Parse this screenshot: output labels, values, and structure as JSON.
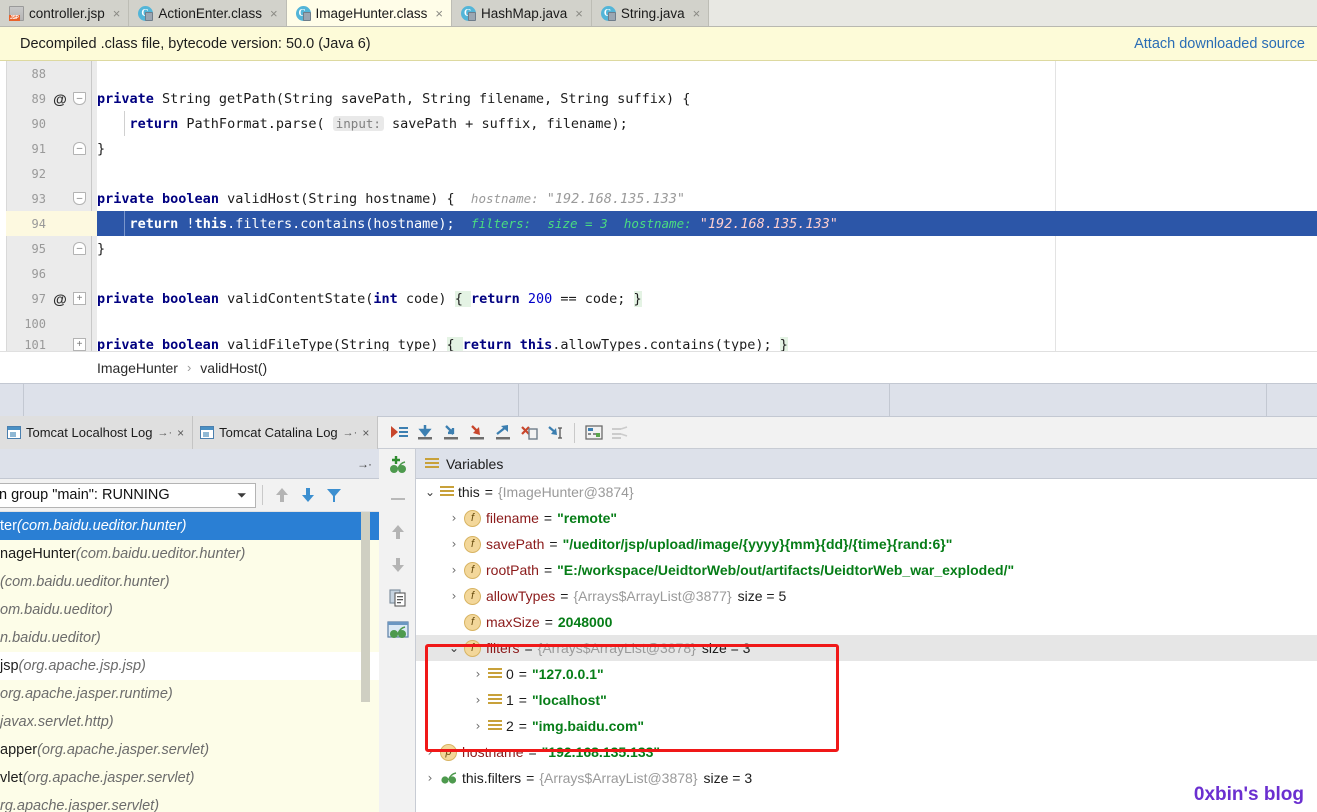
{
  "window": {
    "app": "IntelliJ IDEA Debugger",
    "watermark": "0xbin's blog"
  },
  "editor_tabs": [
    {
      "label": "controller.jsp",
      "icon": "jsp-file-icon",
      "selected": false,
      "close": "×"
    },
    {
      "label": "ActionEnter.class",
      "icon": "class-file-icon",
      "selected": false,
      "close": "×"
    },
    {
      "label": "ImageHunter.class",
      "icon": "class-file-icon",
      "selected": true,
      "close": "×"
    },
    {
      "label": "HashMap.java",
      "icon": "class-file-icon",
      "selected": false,
      "close": "×"
    },
    {
      "label": "String.java",
      "icon": "class-file-icon",
      "selected": false,
      "close": "×"
    }
  ],
  "notification": {
    "message": "Decompiled .class file, bytecode version: 50.0 (Java 6)",
    "action_link": "Attach downloaded source"
  },
  "code": {
    "lines": [
      {
        "num": "88",
        "at": "",
        "fold": "none"
      },
      {
        "num": "89",
        "at": "@",
        "fold": "open"
      },
      {
        "num": "90",
        "at": "",
        "fold": "none"
      },
      {
        "num": "91",
        "at": "",
        "fold": "openend"
      },
      {
        "num": "92",
        "at": "",
        "fold": "none"
      },
      {
        "num": "93",
        "at": "",
        "fold": "open"
      },
      {
        "num": "94",
        "at": "",
        "fold": "none",
        "current": true
      },
      {
        "num": "95",
        "at": "",
        "fold": "openend"
      },
      {
        "num": "96",
        "at": "",
        "fold": "none"
      },
      {
        "num": "97",
        "at": "@",
        "fold": "closed"
      },
      {
        "num": "100",
        "at": "",
        "fold": "none"
      },
      {
        "num": "101",
        "at": "",
        "fold": "closed"
      }
    ],
    "l89": {
      "kw1": "private",
      "rest": " String getPath(String savePath, String filename, String suffix) {"
    },
    "l90": {
      "kw": "return",
      "pre": "    ",
      "mid": " PathFormat.parse(",
      "chip": "input:",
      "post": " savePath + suffix, filename);"
    },
    "l91": {
      "text": "}"
    },
    "l93": {
      "kw1": "private",
      "kw2": "boolean",
      "rest": " validHost(String hostname) {",
      "hint_name": "hostname:",
      "hint_val": "\"192.168.135.133\""
    },
    "l94": {
      "kw1": "return",
      "pre": "    ",
      "rest": " !",
      "kw2": "this",
      "tail": ".filters.contains(hostname);",
      "hint1_name": "filters:",
      "hint1_val": "size = 3",
      "hint2_name": "hostname:",
      "hint2_val": "\"192.168.135.133\""
    },
    "l95": {
      "text": "}"
    },
    "l97": {
      "kw1": "private",
      "kw2": "boolean",
      "mid": " validContentState(",
      "kw3": "int",
      "mid2": " code) ",
      "brace1": "{ ",
      "kw4": "return",
      "num": " 200",
      "tail": " == code; ",
      "brace2": "}"
    },
    "l101": {
      "kw1": "private",
      "kw2": "boolean",
      "mid": " validFileType(String type) ",
      "brace1": "{ ",
      "kw4": "return",
      "kw5": " this",
      "tail": ".allowTypes.contains(type); ",
      "brace2": "}"
    }
  },
  "breadcrumb": {
    "class": "ImageHunter",
    "separator": "›",
    "method": "validHost()"
  },
  "debug_toolbar": {
    "log_tabs": [
      {
        "label": "Tomcat Localhost Log",
        "pin": "→·",
        "close": "×"
      },
      {
        "label": "Tomcat Catalina Log",
        "pin": "→·",
        "close": "×"
      }
    ],
    "buttons": [
      {
        "name": "show-execution-point-icon",
        "title": "Show Execution Point"
      },
      {
        "name": "step-over-icon",
        "title": "Step Over"
      },
      {
        "name": "step-into-icon",
        "title": "Step Into"
      },
      {
        "name": "force-step-into-icon",
        "title": "Force Step Into"
      },
      {
        "name": "step-out-icon",
        "title": "Step Out"
      },
      {
        "name": "drop-frame-icon",
        "title": "Drop Frame"
      },
      {
        "name": "run-to-cursor-icon",
        "title": "Run to Cursor"
      },
      {
        "name": "evaluate-expression-icon",
        "title": "Evaluate Expression"
      },
      {
        "name": "mute-breakpoints-icon",
        "title": "Mute Breakpoints"
      }
    ]
  },
  "frames": {
    "thread_selector": "n group \"main\": RUNNING",
    "toolbar": [
      {
        "name": "frames-up-icon"
      },
      {
        "name": "frames-down-icon"
      },
      {
        "name": "frames-filter-icon"
      }
    ],
    "rows": [
      {
        "text": "ter ",
        "pkg": "(com.baidu.ueditor.hunter)",
        "selected": true
      },
      {
        "text": "nageHunter ",
        "pkg": "(com.baidu.ueditor.hunter)",
        "selected": false
      },
      {
        "text": "",
        "pkg": "(com.baidu.ueditor.hunter)",
        "selected": false
      },
      {
        "text": "",
        "pkg": "om.baidu.ueditor)",
        "selected": false
      },
      {
        "text": "",
        "pkg": "n.baidu.ueditor)",
        "selected": false
      },
      {
        "text": "jsp ",
        "pkg": "(org.apache.jsp.jsp)",
        "selected": false,
        "alt": true
      },
      {
        "text": "",
        "pkg": "org.apache.jasper.runtime)",
        "selected": false
      },
      {
        "text": "",
        "pkg": "javax.servlet.http)",
        "selected": false
      },
      {
        "text": "apper ",
        "pkg": "(org.apache.jasper.servlet)",
        "selected": false
      },
      {
        "text": "vlet ",
        "pkg": "(org.apache.jasper.servlet)",
        "selected": false
      },
      {
        "text": "",
        "pkg": "rg.apache.jasper.servlet)",
        "selected": false
      }
    ]
  },
  "watch_tools": [
    {
      "name": "add-watch-icon"
    },
    {
      "name": "remove-watch-icon"
    },
    {
      "name": "move-watch-up-icon"
    },
    {
      "name": "move-watch-down-icon"
    },
    {
      "name": "copy-value-icon"
    },
    {
      "name": "inspect-variable-icon",
      "active": true
    }
  ],
  "variables": {
    "title": "Variables",
    "rows": [
      {
        "indent": 0,
        "chev": "⌄",
        "badge": "list",
        "name": "this",
        "eq": "=",
        "ref": "{ImageHunter@3874}",
        "dark": true
      },
      {
        "indent": 1,
        "chev": "›",
        "badge": "f",
        "name": "filename",
        "eq": "=",
        "str": "\"remote\""
      },
      {
        "indent": 1,
        "chev": "›",
        "badge": "f",
        "name": "savePath",
        "eq": "=",
        "str": "\"/ueditor/jsp/upload/image/{yyyy}{mm}{dd}/{time}{rand:6}\""
      },
      {
        "indent": 1,
        "chev": "›",
        "badge": "f",
        "name": "rootPath",
        "eq": "=",
        "str": "\"E:/workspace/UeidtorWeb/out/artifacts/UeidtorWeb_war_exploded/\""
      },
      {
        "indent": 1,
        "chev": "›",
        "badge": "f",
        "name": "allowTypes",
        "eq": "=",
        "ref": "{Arrays$ArrayList@3877}",
        "size": "size = 5"
      },
      {
        "indent": 1,
        "chev": "",
        "badge": "f",
        "name": "maxSize",
        "eq": "=",
        "num": "2048000"
      },
      {
        "indent": 1,
        "chev": "⌄",
        "badge": "f",
        "name": "filters",
        "eq": "=",
        "ref": "{Arrays$ArrayList@3878}",
        "size": "size = 3",
        "shaded": true
      },
      {
        "indent": 2,
        "chev": "›",
        "badge": "list",
        "name": "0",
        "eq": "=",
        "str": "\"127.0.0.1\"",
        "dark": true
      },
      {
        "indent": 2,
        "chev": "›",
        "badge": "list",
        "name": "1",
        "eq": "=",
        "str": "\"localhost\"",
        "dark": true
      },
      {
        "indent": 2,
        "chev": "›",
        "badge": "list",
        "name": "2",
        "eq": "=",
        "str": "\"img.baidu.com\"",
        "dark": true
      },
      {
        "indent": 0,
        "chev": "›",
        "badge": "p",
        "name": "hostname",
        "eq": "=",
        "str": "\"192.168.135.133\""
      },
      {
        "indent": 0,
        "chev": "›",
        "badge": "eye",
        "name": "this.filters",
        "eq": "=",
        "ref": "{Arrays$ArrayList@3878}",
        "size": "size = 3",
        "dark": true
      }
    ]
  },
  "annotation": {
    "type": "red-rectangle-highlight",
    "color": "#f01818"
  }
}
